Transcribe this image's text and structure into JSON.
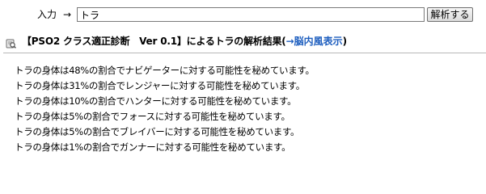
{
  "form": {
    "label": "入力",
    "arrow": "→",
    "input_value": "トラ",
    "button_label": "解析する"
  },
  "header": {
    "title": "【PSO2 クラス適正診断　Ver 0.1】によるトラの解析結果(",
    "link_text": "→脳内風表示",
    "close_paren": ")"
  },
  "results": [
    "トラの身体は48%の割合でナビゲーターに対する可能性を秘めています。",
    "トラの身体は31%の割合でレンジャーに対する可能性を秘めています。",
    "トラの身体は10%の割合でハンターに対する可能性を秘めています。",
    "トラの身体は5%の割合でフォースに対する可能性を秘めています。",
    "トラの身体は5%の割合でブレイバーに対する可能性を秘めています。",
    "トラの身体は1%の割合でガンナーに対する可能性を秘めています。"
  ],
  "icons": {
    "header_icon": "magnifier-document-icon"
  },
  "colors": {
    "link": "#1f5fbf",
    "divider": "#b8b8b8"
  }
}
